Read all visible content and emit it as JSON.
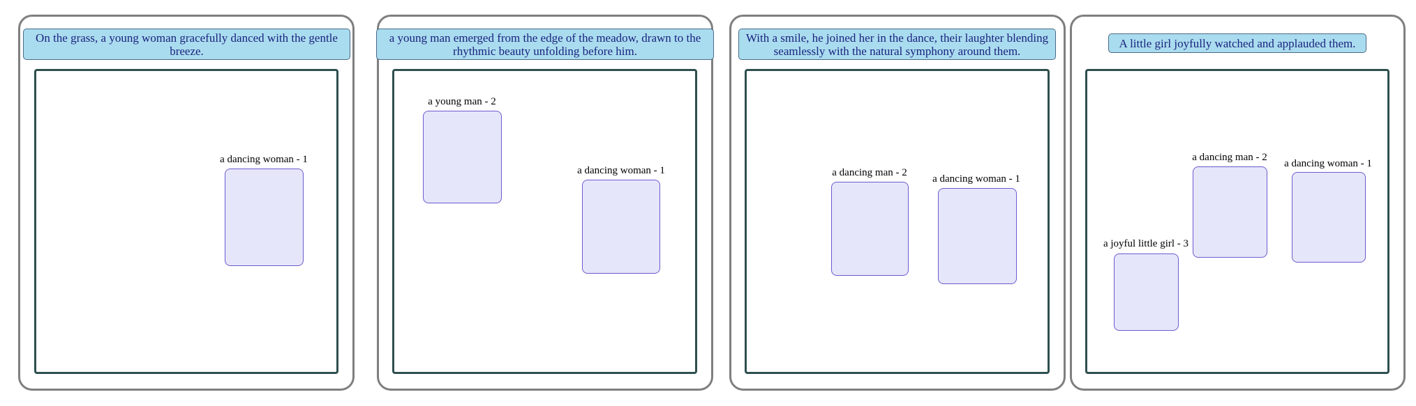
{
  "panels": [
    {
      "caption": "On the grass, a young woman gracefully danced with the gentle breeze.",
      "figures": [
        {
          "label": "a dancing woman - 1"
        }
      ]
    },
    {
      "caption": "a young man emerged from the edge of the meadow, drawn to the rhythmic beauty unfolding before him.",
      "figures": [
        {
          "label": "a young man - 2"
        },
        {
          "label": "a dancing woman - 1"
        }
      ]
    },
    {
      "caption": "With a smile, he joined her in the dance, their laughter blending seamlessly with the natural symphony around them.",
      "figures": [
        {
          "label": "a dancing man - 2"
        },
        {
          "label": "a dancing woman - 1"
        }
      ]
    },
    {
      "caption": "A little girl joyfully watched and applauded them.",
      "figures": [
        {
          "label": "a dancing man - 2"
        },
        {
          "label": "a dancing woman - 1"
        },
        {
          "label": "a joyful little girl - 3"
        }
      ]
    }
  ]
}
